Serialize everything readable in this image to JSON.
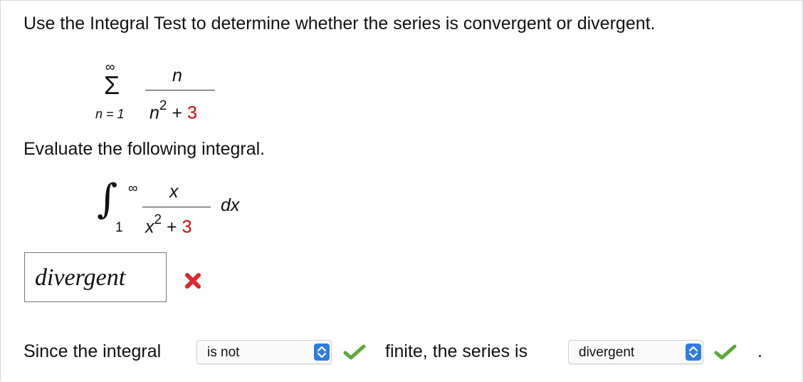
{
  "prompt": "Use the Integral Test to determine whether the series is convergent or divergent.",
  "series": {
    "upper": "∞",
    "sigma": "Σ",
    "lower": "n = 1",
    "numerator": "n",
    "den_var": "n",
    "den_exp": "2",
    "den_plus": "+",
    "den_const": "3"
  },
  "evaluate_label": "Evaluate the following integral.",
  "integral": {
    "sign": "∫",
    "upper": "∞",
    "lower": "1",
    "numerator": "x",
    "den_var": "x",
    "den_exp": "2",
    "den_plus": "+",
    "den_const": "3",
    "differential": "dx"
  },
  "answer": {
    "value": "divergent",
    "status": "incorrect"
  },
  "conclusion": {
    "prefix": "Since the integral",
    "select1_value": "is not",
    "middle": "finite, the series is",
    "select2_value": "divergent",
    "suffix": "."
  },
  "colors": {
    "highlight": "#d40000",
    "correct": "#5aaa3c",
    "incorrect": "#e0262b",
    "select_button": "#2f7de1"
  },
  "icons": {
    "wrong": "cross-icon",
    "right": "check-icon",
    "select": "updown-chevron-icon"
  }
}
